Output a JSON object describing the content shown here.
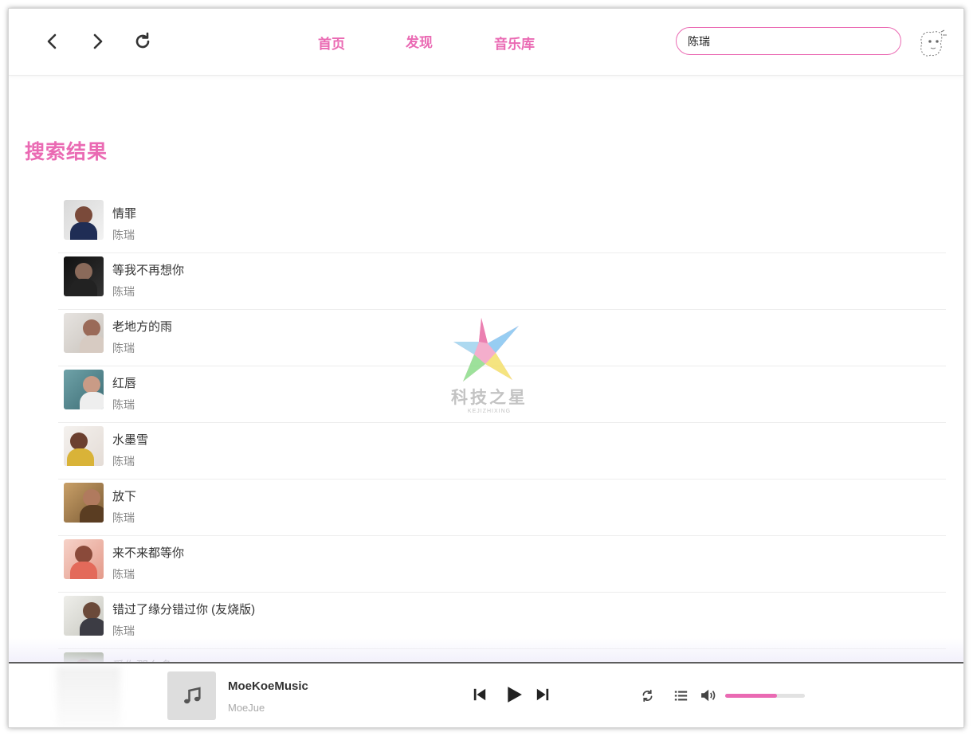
{
  "window_controls": [
    {
      "name": "minimize",
      "color": "#f5a623"
    },
    {
      "name": "maximize",
      "color": "#2ebd4a"
    },
    {
      "name": "close",
      "color": "#f25c5c"
    }
  ],
  "toolbar": {
    "back_icon": "chevron-left-icon",
    "forward_icon": "chevron-right-icon",
    "refresh_icon": "refresh-icon"
  },
  "tabs": [
    {
      "label": "首页"
    },
    {
      "label": "发现"
    },
    {
      "label": "音乐库"
    }
  ],
  "search": {
    "value": "陈瑞"
  },
  "page": {
    "heading": "搜索结果"
  },
  "results": [
    {
      "title": "情罪",
      "artist": "陈瑞"
    },
    {
      "title": "等我不再想你",
      "artist": "陈瑞"
    },
    {
      "title": "老地方的雨",
      "artist": "陈瑞"
    },
    {
      "title": "红唇",
      "artist": "陈瑞"
    },
    {
      "title": "水墨雪",
      "artist": "陈瑞"
    },
    {
      "title": "放下",
      "artist": "陈瑞"
    },
    {
      "title": "来不来都等你",
      "artist": "陈瑞"
    },
    {
      "title": "错过了缘分错过你 (友烧版)",
      "artist": "陈瑞"
    },
    {
      "title": "爱你那么多",
      "artist": ""
    }
  ],
  "watermark": {
    "text": "科技之星",
    "sub": "KEJIZHIXING"
  },
  "player": {
    "title": "MoeKoeMusic",
    "artist": "MoeJue",
    "volume_fraction": 0.65
  },
  "colors": {
    "accent": "#ea6ab3"
  }
}
